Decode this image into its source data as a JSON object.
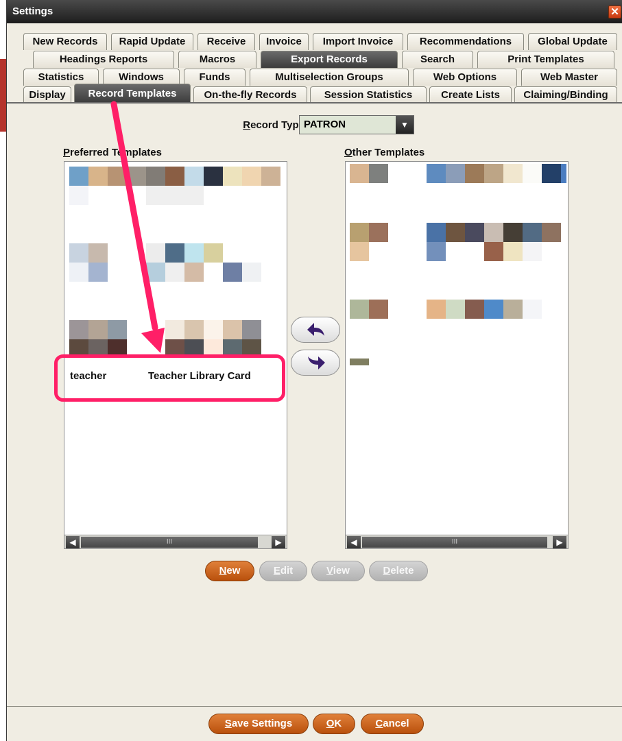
{
  "window": {
    "title": "Settings"
  },
  "tabs": {
    "row1": [
      "New Records",
      "Rapid Update",
      "Receive",
      "Invoice",
      "Import Invoice",
      "Recommendations",
      "Global Update"
    ],
    "row2": [
      "Headings Reports",
      "Macros",
      "Export Records",
      "Search",
      "Print Templates"
    ],
    "row3": [
      "Statistics",
      "Windows",
      "Funds",
      "Multiselection Groups",
      "Web Options",
      "Web Master"
    ],
    "row4": [
      "Display",
      "Record Templates",
      "On-the-fly Records",
      "Session Statistics",
      "Create Lists",
      "Claiming/Binding"
    ]
  },
  "record_type": {
    "label_first": "R",
    "label_rest": "ecord Type",
    "value": "PATRON"
  },
  "preferred": {
    "label_first": "P",
    "label_rest": "referred Templates",
    "items": [
      {
        "code": "teacher",
        "name": "Teacher Library Card"
      }
    ]
  },
  "other": {
    "label_first": "O",
    "label_rest": "ther Templates"
  },
  "scroll_thumb_grip": "III",
  "buttons": {
    "new_first": "N",
    "new_rest": "ew",
    "edit_first": "E",
    "edit_rest": "dit",
    "view_first": "V",
    "view_rest": "iew",
    "delete_first": "D",
    "delete_rest": "elete",
    "save_first": "S",
    "save_rest": "ave Settings",
    "ok_first": "O",
    "ok_rest": "K",
    "cancel_first": "C",
    "cancel_rest": "ancel"
  },
  "icons": {
    "close": "close-icon",
    "move_left": "arrow-left-icon",
    "move_right": "arrow-right-icon",
    "dropdown": "chevron-down-icon"
  },
  "colors": {
    "accent_orange": "#d06a22",
    "annotation_pink": "#ff1f67",
    "arrow_purple": "#3a1f6e",
    "panel_bg": "#f0ede3"
  }
}
